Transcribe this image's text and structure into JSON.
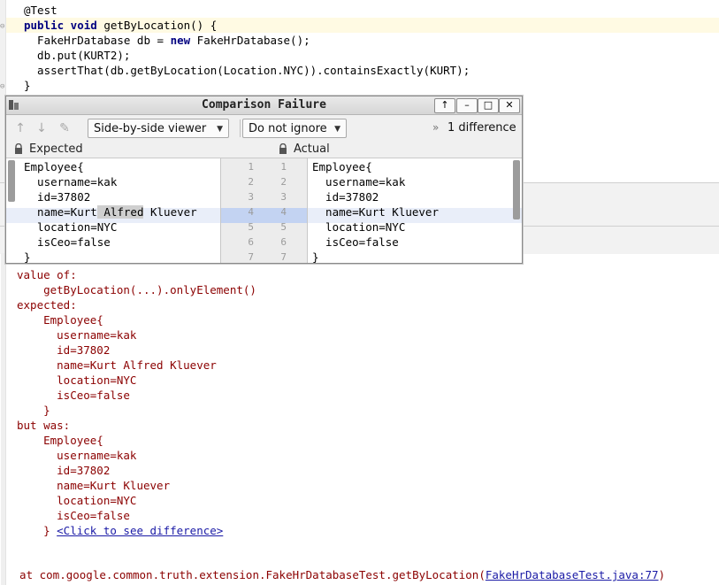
{
  "editor": {
    "lines": [
      {
        "plain": "@Test"
      },
      {
        "kw": "public void",
        "rest": " getByLocation() {"
      },
      {
        "pre": "  FakeHrDatabase db = ",
        "kw": "new",
        "rest": " FakeHrDatabase();"
      },
      {
        "plain": "  db.put(KURT2);"
      },
      {
        "plain": "  assertThat(db.getByLocation(Location.NYC)).containsExactly(KURT);"
      },
      {
        "plain": "}"
      }
    ]
  },
  "dialog": {
    "title": "Comparison Failure",
    "title_buttons": [
      "↑",
      "–",
      "□",
      "✕"
    ],
    "toolbar": {
      "viewer_select": "Side-by-side viewer",
      "whitespace_select": "Do not ignore",
      "diff_count": "1 difference",
      "more_icon": "»"
    },
    "expected_label": "Expected",
    "actual_label": "Actual",
    "expected_lines": [
      "Employee{",
      "  username=kak",
      "  id=37802",
      "  name=Kurt Alfred Kluever",
      "  location=NYC",
      "  isCeo=false",
      "}"
    ],
    "actual_lines": [
      "Employee{",
      "  username=kak",
      "  id=37802",
      "  name=Kurt Kluever",
      "  location=NYC",
      "  isCeo=false",
      "}"
    ],
    "changed_word": " Alfred",
    "line_numbers": [
      "1",
      "2",
      "3",
      "4",
      "5",
      "6",
      "7"
    ]
  },
  "console": {
    "lines": [
      "value of:",
      "    getByLocation(...).onlyElement()",
      "expected:",
      "    Employee{",
      "      username=kak",
      "      id=37802",
      "      name=Kurt Alfred Kluever",
      "      location=NYC",
      "      isCeo=false",
      "    }",
      "but was:",
      "    Employee{",
      "      username=kak",
      "      id=37802",
      "      name=Kurt Kluever",
      "      location=NYC",
      "      isCeo=false"
    ],
    "closing_brace": "    }",
    "click_link": "<Click to see difference>",
    "stack_prefix": "  at com.google.common.truth.extension.FakeHrDatabaseTest.getByLocation(",
    "stack_link": "FakeHrDatabaseTest.java:77",
    "stack_suffix": ")"
  },
  "colors": {
    "console_text": "#8b0000",
    "link": "#1a1aa6",
    "keyword": "#000080",
    "changed_line": "#e9eef9",
    "changed_word": "#cfcfcf"
  }
}
